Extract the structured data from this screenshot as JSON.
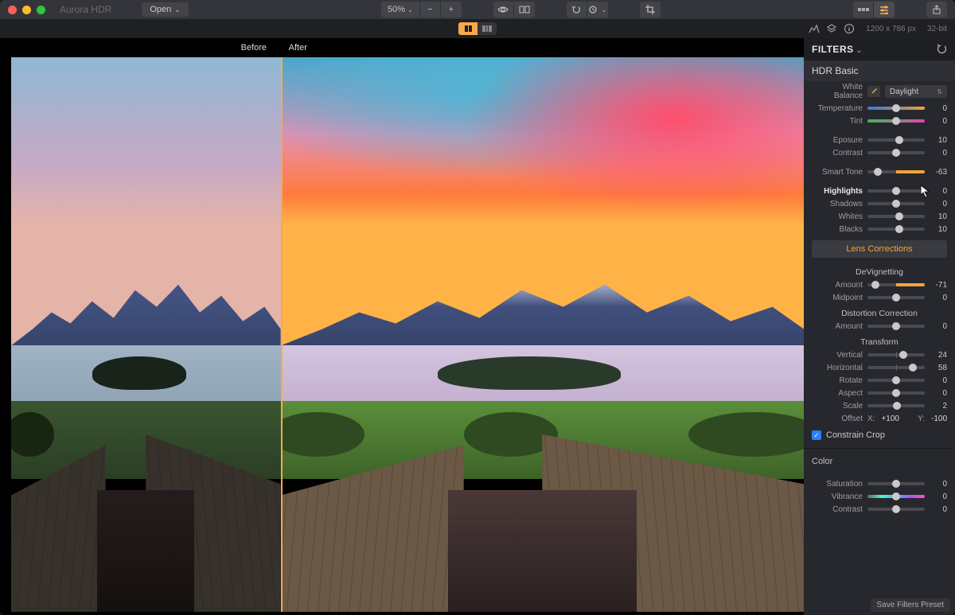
{
  "app": {
    "title": "Aurora HDR",
    "open_label": "Open"
  },
  "toolbar": {
    "zoom": "50%",
    "dimensions": "1200 x 786 px",
    "bitdepth": "32-bit"
  },
  "compare": {
    "before": "Before",
    "after": "After"
  },
  "filters": {
    "header": "FILTERS",
    "hdr_basic": {
      "title": "HDR Basic",
      "white_balance_label": "White Balance",
      "white_balance_value": "Daylight",
      "sliders": [
        {
          "label": "Temperature",
          "value": 0,
          "pos": 50,
          "kind": "temp"
        },
        {
          "label": "Tint",
          "value": 0,
          "pos": 50,
          "kind": "tint"
        },
        {
          "label": "Eposure",
          "value": 10,
          "pos": 55,
          "kind": "plain"
        },
        {
          "label": "Contrast",
          "value": 0,
          "pos": 50,
          "kind": "plain"
        },
        {
          "label": "Smart Tone",
          "value": -63,
          "pos": 18,
          "kind": "st"
        },
        {
          "label": "Highlights",
          "value": 0,
          "pos": 50,
          "kind": "plain",
          "bold": true
        },
        {
          "label": "Shadows",
          "value": 0,
          "pos": 50,
          "kind": "plain"
        },
        {
          "label": "Whites",
          "value": 10,
          "pos": 55,
          "kind": "plain"
        },
        {
          "label": "Blacks",
          "value": 10,
          "pos": 55,
          "kind": "plain"
        }
      ]
    },
    "lens_button": "Lens Corrections",
    "devignetting": {
      "title": "DeVignetting",
      "sliders": [
        {
          "label": "Amount",
          "value": -71,
          "pos": 14,
          "kind": "st"
        },
        {
          "label": "Midpoint",
          "value": 0,
          "pos": 50,
          "kind": "plain"
        }
      ]
    },
    "distortion": {
      "title": "Distortion Correction",
      "sliders": [
        {
          "label": "Amount",
          "value": 0,
          "pos": 50,
          "kind": "plain"
        }
      ]
    },
    "transform": {
      "title": "Transform",
      "sliders": [
        {
          "label": "Vertical",
          "value": 24,
          "pos": 62,
          "kind": "plain"
        },
        {
          "label": "Horizontal",
          "value": 58,
          "pos": 79,
          "kind": "plain"
        },
        {
          "label": "Rotate",
          "value": 0,
          "pos": 50,
          "kind": "plain"
        },
        {
          "label": "Aspect",
          "value": 0,
          "pos": 50,
          "kind": "plain"
        },
        {
          "label": "Scale",
          "value": 2,
          "pos": 51,
          "kind": "plain"
        }
      ],
      "offset_label": "Offset",
      "offset_x_label": "X:",
      "offset_x": "+100",
      "offset_y_label": "Y:",
      "offset_y": "-100"
    },
    "constrain_crop": "Constrain Crop",
    "color": {
      "title": "Color",
      "sliders": [
        {
          "label": "Saturation",
          "value": 0,
          "pos": 50,
          "kind": "plain"
        },
        {
          "label": "Vibrance",
          "value": 0,
          "pos": 50,
          "kind": "vib"
        },
        {
          "label": "Contrast",
          "value": 0,
          "pos": 50,
          "kind": "plain"
        }
      ]
    },
    "save_preset": "Save Filters Preset"
  }
}
